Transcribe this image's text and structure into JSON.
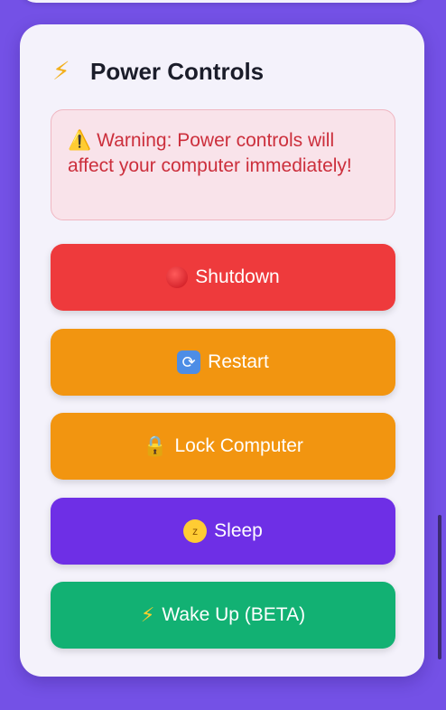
{
  "card": {
    "title": "Power Controls",
    "title_icon": "lightning-bolt-icon",
    "warning": {
      "icon": "warning-triangle-icon",
      "icon_glyph": "⚠️",
      "text": "Warning: Power controls will affect your computer immediately!"
    },
    "buttons": [
      {
        "label": "Shutdown",
        "icon": "red-circle-icon",
        "color": "#ee3a3c"
      },
      {
        "label": "Restart",
        "icon": "restart-arrows-icon",
        "color": "#f29510"
      },
      {
        "label": "Lock Computer",
        "icon": "padlock-icon",
        "color": "#f29510"
      },
      {
        "label": "Sleep",
        "icon": "sleeping-face-icon",
        "color": "#6e2fe6"
      },
      {
        "label": "Wake Up (BETA)",
        "icon": "lightning-bolt-icon",
        "color": "#12b173"
      }
    ]
  },
  "colors": {
    "background": "#7451e6",
    "card": "#f4f2fb",
    "warning_bg": "#f9e3ea",
    "warning_text": "#cc2f3c"
  }
}
